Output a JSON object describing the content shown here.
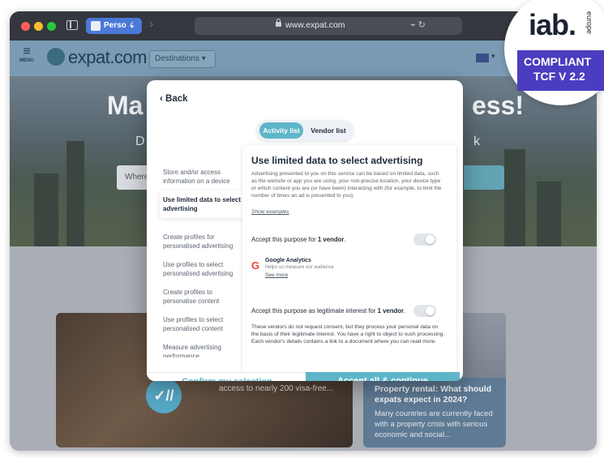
{
  "browser": {
    "profile_label": "Perso",
    "url": "www.expat.com"
  },
  "site": {
    "menu_label": "MENU",
    "logo_text": "expat.com",
    "destinations_label": "Destinations ▾",
    "hero_title_left": "Ma",
    "hero_title_right": "ess!",
    "hero_sub_left": "D",
    "hero_sub_right": "k",
    "hero_search_label": "Where",
    "card_caption": "access to nearly 200 visa-free...",
    "card_right_title": "Property rental: What should expats expect in 2024?",
    "card_right_desc": "Many countries are currently faced with a property crisis with serious economic and social..."
  },
  "modal": {
    "back_label": "‹  Back",
    "tabs": [
      {
        "label": "Activity list",
        "active": true
      },
      {
        "label": "Vendor list",
        "active": false
      }
    ],
    "purposes": [
      "Store and/or access information on a device",
      "Use limited data to select advertising",
      "Create profiles for personalised advertising",
      "Use profiles to select personalised advertising",
      "Create profiles to personalise content",
      "Use profiles to select personalised content",
      "Measure advertising performance"
    ],
    "selected_purpose_index": 1,
    "detail": {
      "title": "Use limited data to select advertising",
      "description": "Advertising presented to you on this service can be based on limited data, such as the website or app you are using, your non-precise location, your device type or which content you are (or have been) interacting with (for example, to limit the number of times an ad is presented to you).",
      "show_examples": "Show examples",
      "accept_prefix": "Accept this purpose for ",
      "accept_bold": "1 vendor",
      "accept_suffix": ".",
      "vendor_name": "Google Analytics",
      "vendor_desc": "Helps us measure our audience",
      "see_more": "See more",
      "legit_prefix": "Accept this purpose as legitimate interest for ",
      "legit_bold": "1 vendor",
      "legit_suffix": ".",
      "legit_text": "These vendors do not request consent, but they process your personal data on the basis of their legitimate interest. You have a right to object to such processing. Each vendor's details contains a link to a document where you can read more."
    },
    "confirm_label": "Confirm my selection",
    "accept_all_label": "Accept all & continue"
  },
  "badge": {
    "logo": "iab.",
    "region": "europe",
    "compliant": "COMPLIANT",
    "tcf": "TCF V 2.2"
  },
  "colors": {
    "accent": "#5eb5c9",
    "iab_purple": "#4b3dbf"
  }
}
